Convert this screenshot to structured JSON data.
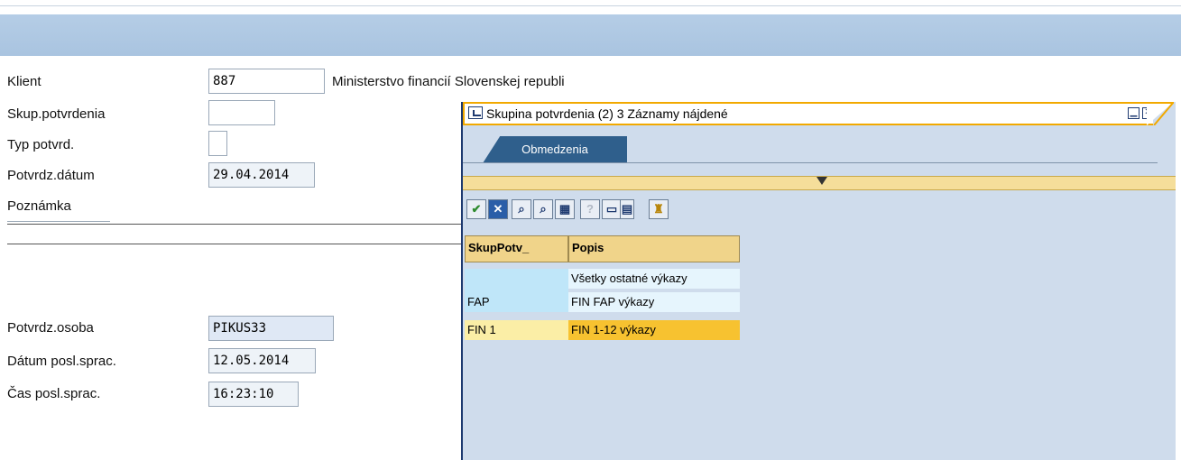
{
  "form": {
    "client_label": "Klient",
    "client_value": "887",
    "client_name": "Ministerstvo financií Slovenskej republi",
    "group_label": "Skup.potvrdenia",
    "group_value": "",
    "type_label": "Typ potvrd.",
    "type_value": "",
    "date_label": "Potvrdz.dátum",
    "date_value": "29.04.2014",
    "note_label": "Poznámka",
    "person_label": "Potvrdz.osoba",
    "person_value": "PIKUS33",
    "lastdate_label": "Dátum posl.sprac.",
    "lastdate_value": "12.05.2014",
    "lasttime_label": "Čas posl.sprac.",
    "lasttime_value": "16:23:10"
  },
  "dialog": {
    "title": "Skupina potvrdenia (2)   3 Záznamy nájdené",
    "tab_label": "Obmedzenia",
    "columns": [
      "SkupPotv_",
      "Popis"
    ],
    "rows": [
      {
        "key": "",
        "desc": "Všetky ostatné výkazy",
        "selected": false
      },
      {
        "key": "FAP",
        "desc": "FIN FAP výkazy",
        "selected": false
      },
      {
        "key": "FIN 1",
        "desc": "FIN 1-12 výkazy",
        "selected": true
      }
    ]
  },
  "icons": [
    "checkmark-icon",
    "cancel-icon",
    "find-icon",
    "find-next-icon",
    "insert-icon",
    "help-icon",
    "print-icon",
    "print-preview-icon",
    "sort-icon",
    "minimize-icon",
    "close-icon",
    "window-icon",
    "filter-triangle-icon"
  ],
  "colors": {
    "accent": "#f2a900",
    "selected_row": "#f7c230",
    "header_band": "#b5cde6",
    "tab": "#2f5f8c"
  }
}
